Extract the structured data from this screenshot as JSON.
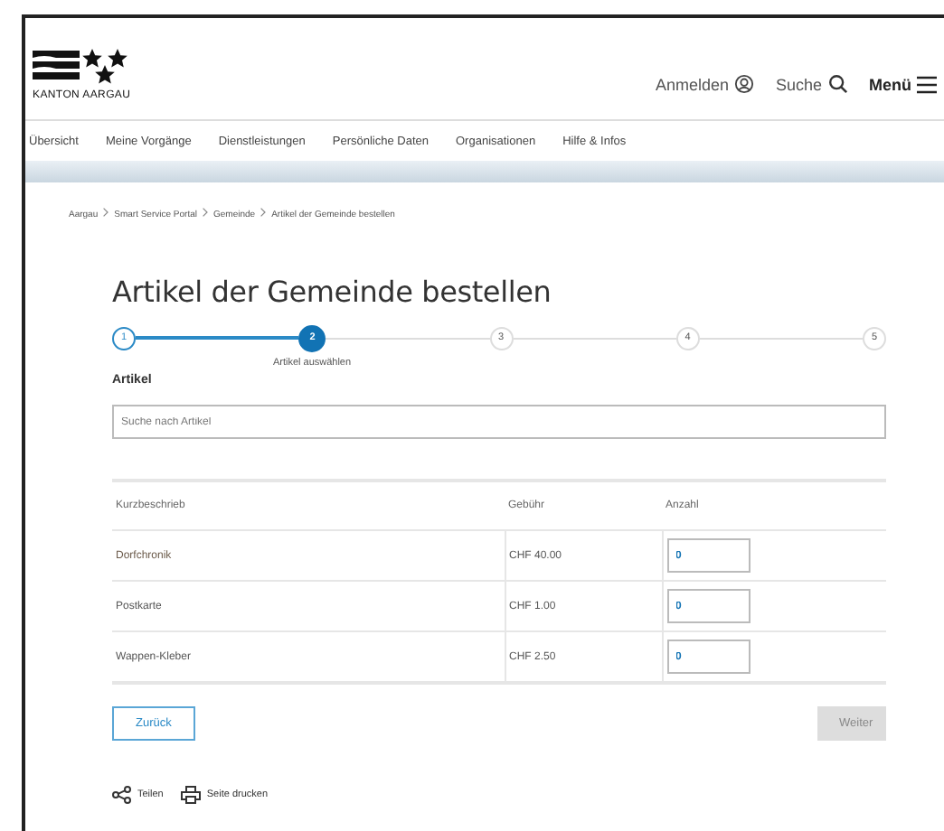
{
  "header": {
    "logo_text": "KANTON AARGAU",
    "actions": [
      {
        "label": "Anmelden",
        "kind": "login"
      },
      {
        "label": "Suche",
        "kind": "search"
      },
      {
        "label": "Menü",
        "kind": "menu"
      }
    ]
  },
  "nav": [
    "Übersicht",
    "Meine Vorgänge",
    "Dienstleistungen",
    "Persönliche Daten",
    "Organisationen",
    "Hilfe & Infos"
  ],
  "breadcrumb": [
    "Aargau",
    "Smart Service Portal",
    "Gemeinde",
    "Artikel der Gemeinde bestellen"
  ],
  "title": "Artikel der Gemeinde bestellen",
  "steps": [
    {
      "number": "1",
      "completed": true,
      "selected": false
    },
    {
      "number": "2",
      "completed": false,
      "selected": true,
      "label": "Artikel auswählen"
    },
    {
      "number": "3",
      "completed": false,
      "selected": false
    },
    {
      "number": "4",
      "completed": false,
      "selected": false
    },
    {
      "number": "5",
      "completed": false,
      "selected": false
    }
  ],
  "section_label": "Artikel",
  "search": {
    "placeholder": "Suche nach Artikel"
  },
  "table": {
    "columns": [
      "Kurzbeschrieb",
      "Gebühr",
      "Anzahl"
    ],
    "rows": [
      {
        "name": "Dorfchronik",
        "fee": "CHF 40.00",
        "quantity": "0"
      },
      {
        "name": "Postkarte",
        "fee": "CHF 1.00",
        "quantity": "0"
      },
      {
        "name": "Wappen-Kleber",
        "fee": "CHF 2.50",
        "quantity": "0"
      }
    ]
  },
  "buttons": [
    {
      "label": "Zurück",
      "disabled": false
    },
    {
      "label": "Weiter",
      "disabled": true
    }
  ],
  "footer_links": [
    {
      "label": "Teilen",
      "kind": "share"
    },
    {
      "label": "Seite drucken",
      "kind": "print"
    }
  ]
}
